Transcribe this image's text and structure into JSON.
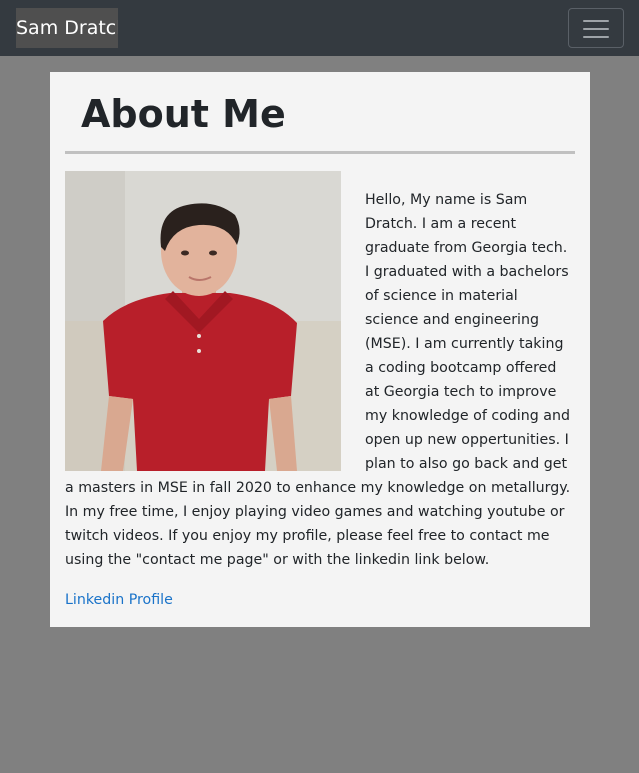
{
  "navbar": {
    "brand": "Sam Dratch",
    "toggler_icon": "hamburger-menu-icon"
  },
  "about": {
    "title": "About Me",
    "photo_icon": "profile-photo",
    "bio": "Hello, My name is Sam Dratch. I am a recent graduate from Georgia tech. I graduated with a bachelors of science in material science and engineering (MSE). I am currently taking a coding bootcamp offered at Georgia tech to improve my knowledge of coding and open up new oppertunities. I plan to also go back and get a masters in MSE in fall 2020 to enhance my knowledge on metallurgy. In my free time, I enjoy playing video games and watching youtube or twitch videos. If you enjoy my profile, please feel free to contact me using the \"contact me page\" or with the linkedin link below.",
    "linkedin_label": "Linkedin Profile"
  },
  "colors": {
    "navbar_bg": "#343a40",
    "page_bg": "#808080",
    "card_bg": "#f4f4f4",
    "link": "#1a73c9"
  }
}
